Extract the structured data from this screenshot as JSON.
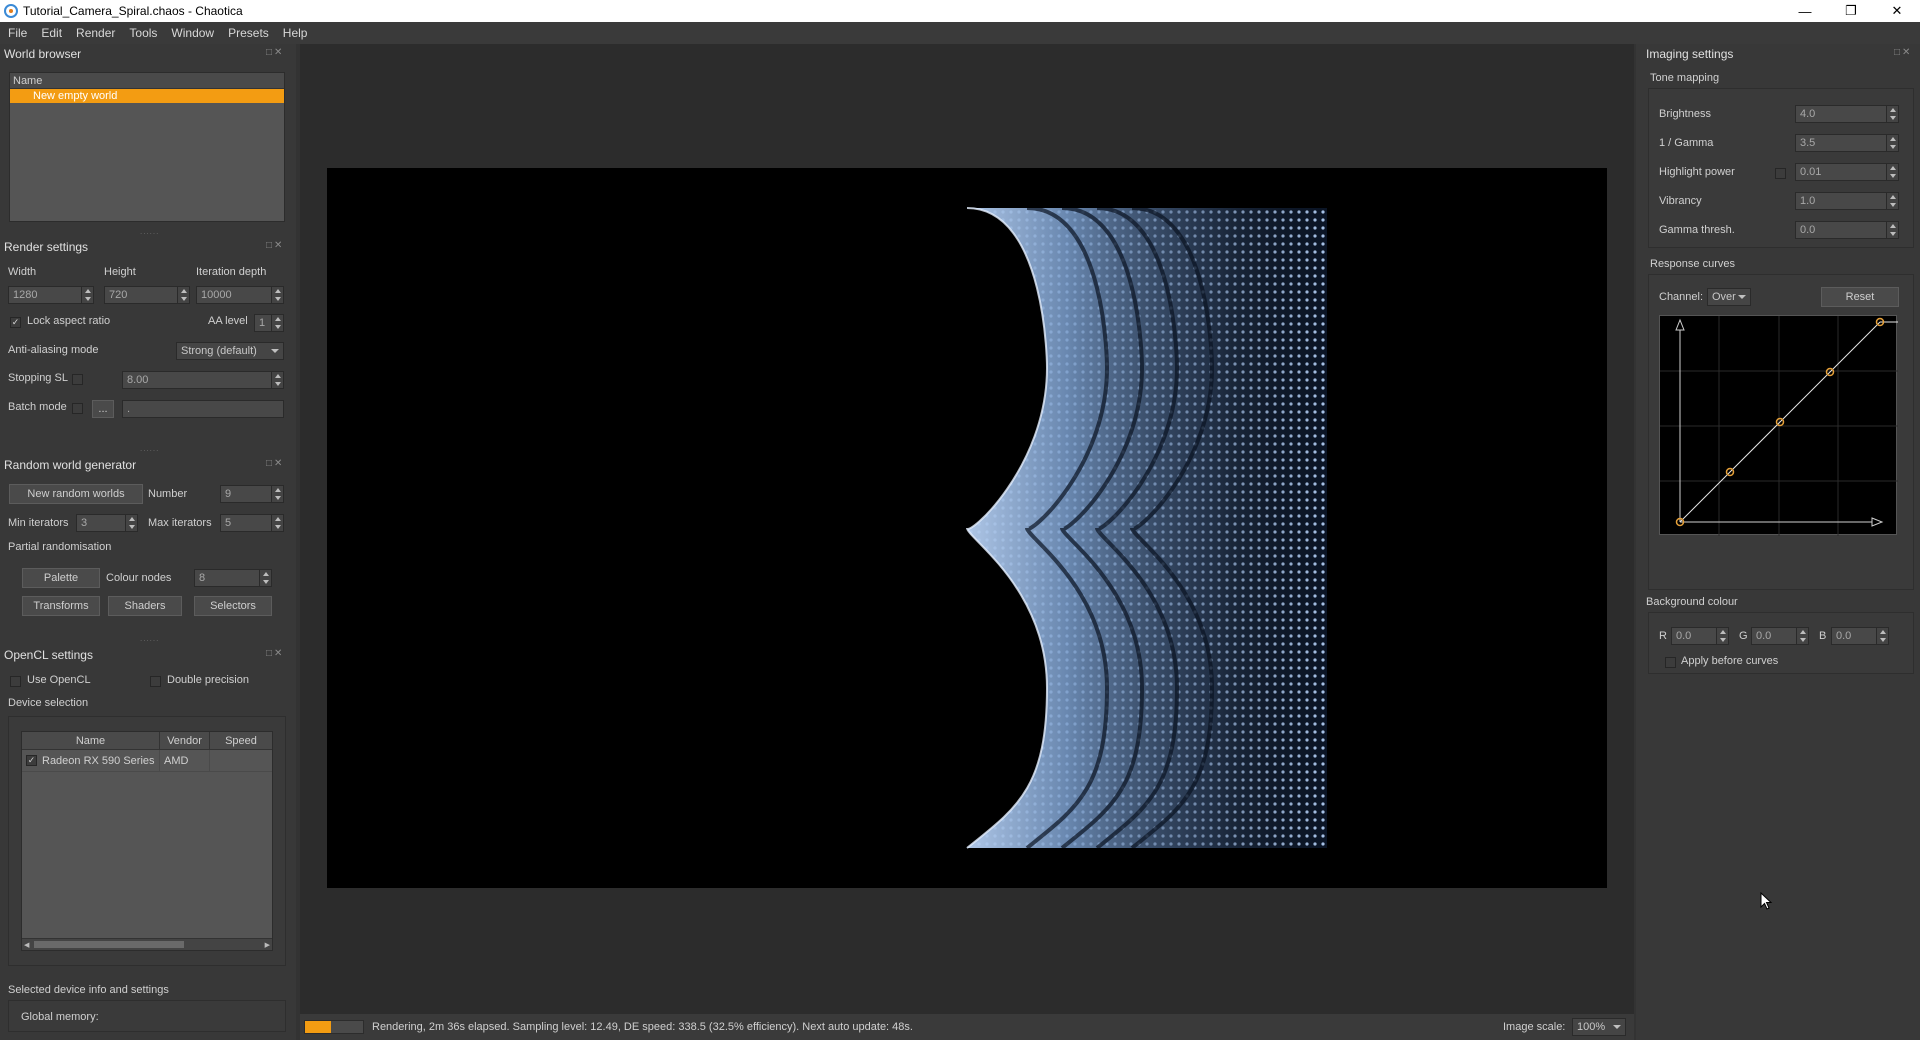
{
  "window": {
    "title": "Tutorial_Camera_Spiral.chaos - Chaotica"
  },
  "menu": [
    "File",
    "Edit",
    "Render",
    "Tools",
    "Window",
    "Presets",
    "Help"
  ],
  "world_browser": {
    "title": "World browser",
    "column": "Name",
    "items": [
      "New empty world"
    ]
  },
  "render_settings": {
    "title": "Render settings",
    "width_label": "Width",
    "height_label": "Height",
    "iter_label": "Iteration depth",
    "width": "1280",
    "height": "720",
    "iter": "10000",
    "lock_label": "Lock aspect ratio",
    "lock_checked": "✓",
    "aa_level_label": "AA level",
    "aa_level": "1",
    "aa_mode_label": "Anti-aliasing mode",
    "aa_mode": "Strong (default)",
    "stopping_label": "Stopping SL",
    "stopping": "8.00",
    "batch_label": "Batch mode",
    "batch_btn": "...",
    "batch_path": "."
  },
  "random_world": {
    "title": "Random world generator",
    "new_btn": "New random worlds",
    "number_label": "Number",
    "number": "9",
    "min_label": "Min iterators",
    "min": "3",
    "max_label": "Max iterators",
    "max": "5",
    "partial_label": "Partial randomisation",
    "palette_btn": "Palette",
    "colour_nodes_label": "Colour nodes",
    "colour_nodes": "8",
    "transforms_btn": "Transforms",
    "shaders_btn": "Shaders",
    "selectors_btn": "Selectors"
  },
  "opencl": {
    "title": "OpenCL settings",
    "use_label": "Use OpenCL",
    "double_label": "Double precision",
    "device_label": "Device selection",
    "columns": [
      "Name",
      "Vendor",
      "Speed"
    ],
    "devices": [
      {
        "check": "✓",
        "name": "Radeon RX 590 Series",
        "vendor": "AMD",
        "speed": ""
      }
    ],
    "selected_info": "Selected device info and settings",
    "global_memory": "Global memory:"
  },
  "imaging": {
    "title": "Imaging settings",
    "tone_mapping": "Tone mapping",
    "brightness_label": "Brightness",
    "brightness": "4.0",
    "gamma_label": "1 / Gamma",
    "gamma": "3.5",
    "highlight_label": "Highlight power",
    "highlight": "0.01",
    "vibrancy_label": "Vibrancy",
    "vibrancy": "1.0",
    "gamma_thresh_label": "Gamma thresh.",
    "gamma_thresh": "0.0",
    "response_curves": "Response curves",
    "channel_label": "Channel:",
    "channel": "Over",
    "reset_btn": "Reset",
    "curve_points": [
      [
        0,
        0
      ],
      [
        0.25,
        0.25
      ],
      [
        0.5,
        0.5
      ],
      [
        0.75,
        0.75
      ],
      [
        1,
        1
      ]
    ],
    "background_colour": "Background colour",
    "r_label": "R",
    "r": "0.0",
    "g_label": "G",
    "g": "0.0",
    "b_label": "B",
    "b": "0.0",
    "apply_before": "Apply before curves"
  },
  "status": {
    "text": "Rendering, 2m 36s elapsed. Sampling level: 12.49, DE speed: 338.5 (32.5% efficiency). Next auto update: 48s.",
    "progress": 0.45,
    "scale_label": "Image scale:",
    "scale": "100%"
  },
  "colors": {
    "accent": "#f39c12",
    "curve": "#e8a23a"
  }
}
